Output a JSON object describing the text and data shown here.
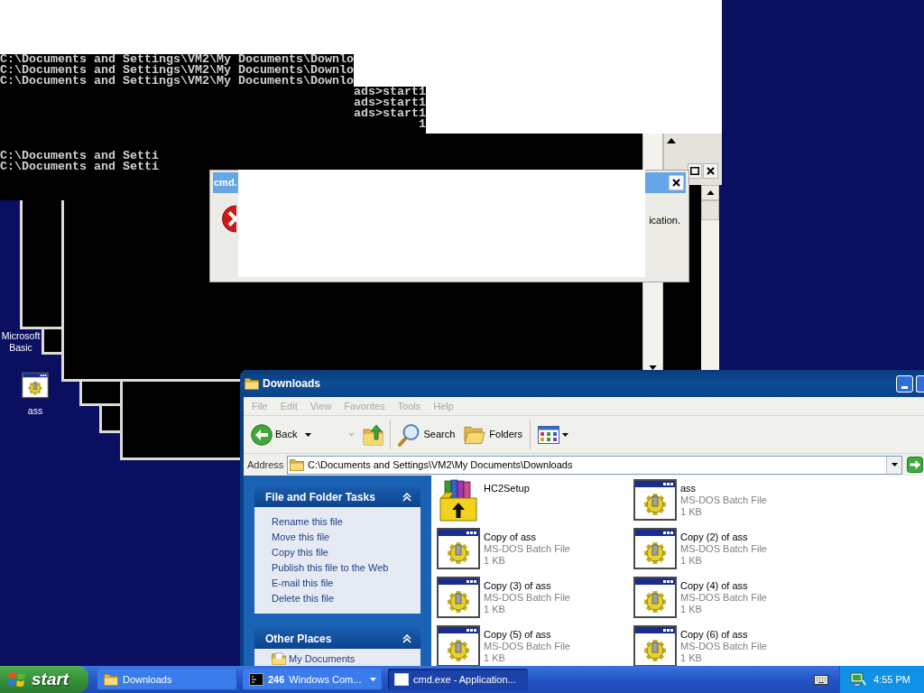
{
  "console_fragments": [
    {
      "lines": [
        "C:\\Documents and Settings\\VM2\\My Documents\\Downlo",
        "C:\\Documents and Settings\\VM2\\My Documents\\Downlo",
        "C:\\Documents and Settings\\VM2\\My Documents\\Downlo"
      ]
    },
    {
      "lines": [
        "ads>start1",
        "ads>start1",
        "ads>start1",
        "1"
      ]
    },
    {
      "lines": [
        "C:\\Documents and Setti",
        "C:\\Documents and Setti"
      ]
    }
  ],
  "error_dialog": {
    "title": "cmd.",
    "message": "ication."
  },
  "desktop_icons": [
    {
      "label": "Microsoft Basic",
      "kind": "covered"
    },
    {
      "label": "ass",
      "kind": "batch"
    }
  ],
  "explorer": {
    "title": "Downloads",
    "menu": [
      {
        "label": "File",
        "disabled": true
      },
      {
        "label": "Edit",
        "disabled": true
      },
      {
        "label": "View",
        "disabled": true
      },
      {
        "label": "Favorites",
        "disabled": true
      },
      {
        "label": "Tools",
        "disabled": true
      },
      {
        "label": "Help",
        "disabled": true
      }
    ],
    "toolbar": [
      {
        "kind": "back",
        "label": "Back"
      },
      {
        "kind": "forward",
        "disabled": true
      },
      {
        "kind": "up"
      },
      {
        "kind": "search",
        "label": "Search"
      },
      {
        "kind": "folders",
        "label": "Folders"
      },
      {
        "kind": "views"
      }
    ],
    "address": {
      "label": "Address",
      "value": "C:\\Documents and Settings\\VM2\\My Documents\\Downloads"
    },
    "task_panels": [
      {
        "title": "File and Folder Tasks",
        "expanded": true,
        "items": [
          {
            "label": "Rename this file",
            "kind": "task"
          },
          {
            "label": "Move this file",
            "kind": "task"
          },
          {
            "label": "Copy this file",
            "kind": "task"
          },
          {
            "label": "Publish this file to the Web",
            "kind": "task"
          },
          {
            "label": "E-mail this file",
            "kind": "task"
          },
          {
            "label": "Delete this file",
            "kind": "task"
          }
        ]
      },
      {
        "title": "Other Places",
        "expanded": true,
        "items": [
          {
            "label": "My Documents",
            "kind": "place"
          }
        ]
      }
    ],
    "files": [
      {
        "name": "HC2Setup",
        "kind": "installer"
      },
      {
        "name": "ass",
        "type": "MS-DOS Batch File",
        "size": "1 KB",
        "kind": "batch"
      },
      {
        "name": "Copy of ass",
        "type": "MS-DOS Batch File",
        "size": "1 KB",
        "kind": "batch"
      },
      {
        "name": "Copy (2) of ass",
        "type": "MS-DOS Batch File",
        "size": "1 KB",
        "kind": "batch"
      },
      {
        "name": "Copy (3) of ass",
        "type": "MS-DOS Batch File",
        "size": "1 KB",
        "kind": "batch"
      },
      {
        "name": "Copy (4) of ass",
        "type": "MS-DOS Batch File",
        "size": "1 KB",
        "kind": "batch"
      },
      {
        "name": "Copy (5) of ass",
        "type": "MS-DOS Batch File",
        "size": "1 KB",
        "kind": "batch"
      },
      {
        "name": "Copy (6) of ass",
        "type": "MS-DOS Batch File",
        "size": "1 KB",
        "kind": "batch"
      }
    ]
  },
  "taskbar": {
    "start": "start",
    "tasks": [
      {
        "kind": "folder",
        "label": "Downloads",
        "selected": false
      },
      {
        "kind": "console-group",
        "count": "246",
        "label": "Windows Com...",
        "selected": false
      },
      {
        "kind": "window",
        "label": "cmd.exe - Application...",
        "selected": true
      }
    ],
    "clock": "4:55 PM"
  }
}
